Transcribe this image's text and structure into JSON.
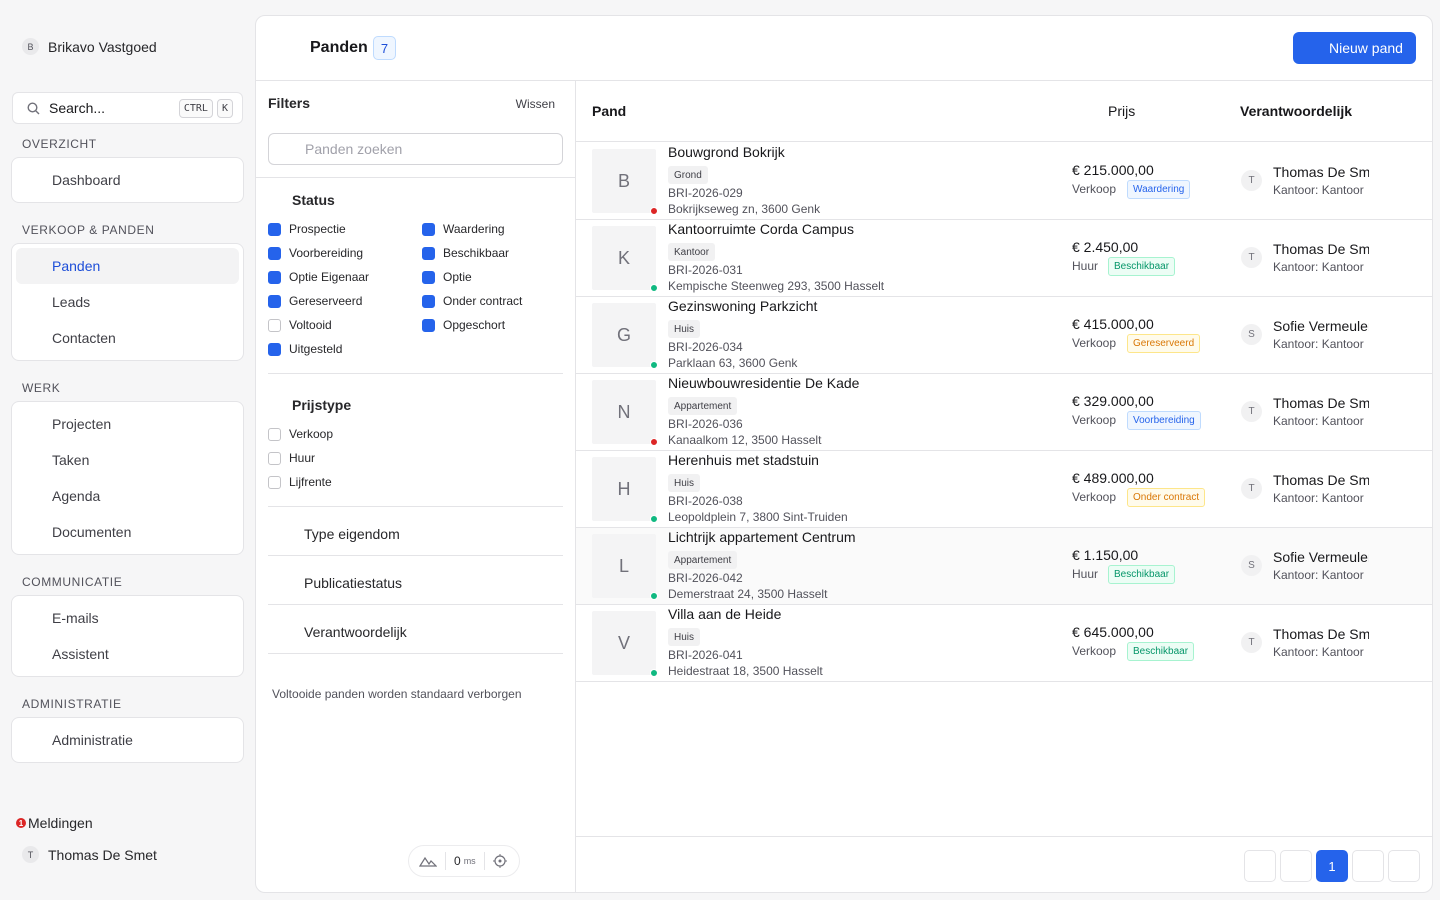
{
  "sidebar": {
    "brand": {
      "initial": "B",
      "name": "Brikavo Vastgoed"
    },
    "search": {
      "placeholder": "Search...",
      "keys": [
        "CTRL",
        "K"
      ]
    },
    "sections": [
      {
        "label": "OVERZICHT",
        "items": [
          "Dashboard"
        ]
      },
      {
        "label": "VERKOOP & PANDEN",
        "items": [
          "Panden",
          "Leads",
          "Contacten"
        ],
        "active": "Panden"
      },
      {
        "label": "WERK",
        "items": [
          "Projecten",
          "Taken",
          "Agenda",
          "Documenten"
        ]
      },
      {
        "label": "COMMUNICATIE",
        "items": [
          "E-mails",
          "Assistent"
        ]
      },
      {
        "label": "ADMINISTRATIE",
        "items": [
          "Administratie"
        ]
      }
    ],
    "notifications": {
      "label": "Meldingen",
      "count": "1"
    },
    "user": {
      "initial": "T",
      "name": "Thomas De Smet"
    }
  },
  "header": {
    "title": "Panden",
    "count": "7",
    "new_button": "Nieuw pand"
  },
  "filters": {
    "title": "Filters",
    "clear": "Wissen",
    "search_placeholder": "Panden zoeken",
    "status_title": "Status",
    "status": [
      {
        "label": "Prospectie",
        "checked": true
      },
      {
        "label": "Waardering",
        "checked": true
      },
      {
        "label": "Voorbereiding",
        "checked": true
      },
      {
        "label": "Beschikbaar",
        "checked": true
      },
      {
        "label": "Optie Eigenaar",
        "checked": true
      },
      {
        "label": "Optie",
        "checked": true
      },
      {
        "label": "Gereserveerd",
        "checked": true
      },
      {
        "label": "Onder contract",
        "checked": true
      },
      {
        "label": "Voltooid",
        "checked": false
      },
      {
        "label": "Opgeschort",
        "checked": true
      },
      {
        "label": "Uitgesteld",
        "checked": true
      }
    ],
    "price_type_title": "Prijstype",
    "price_types": [
      {
        "label": "Verkoop",
        "checked": false
      },
      {
        "label": "Huur",
        "checked": false
      },
      {
        "label": "Lijfrente",
        "checked": false
      }
    ],
    "sections": [
      "Type eigendom",
      "Publicatiestatus",
      "Verantwoordelijk"
    ],
    "note": "Voltooide panden worden standaard verborgen"
  },
  "table": {
    "columns": {
      "pand": "Pand",
      "prijs": "Prijs",
      "verantwoordelijk": "Verantwoordelijk"
    },
    "rows": [
      {
        "initial": "B",
        "name": "Bouwgrond Bokrijk",
        "type": "Grond",
        "ref": "BRI-2026-029",
        "address": "Bokrijkseweg zn, 3600 Genk",
        "price": "€ 215.000,00",
        "price_type": "Verkoop",
        "status": "Waardering",
        "status_color": "blue",
        "dot_color": "#dc2626",
        "owner_initial": "T",
        "owner": "Thomas De Smet",
        "office": "Kantoor: Kantoor"
      },
      {
        "initial": "K",
        "name": "Kantoorruimte Corda Campus",
        "type": "Kantoor",
        "ref": "BRI-2026-031",
        "address": "Kempische Steenweg 293, 3500 Hasselt",
        "price": "€ 2.450,00",
        "price_type": "Huur",
        "status": "Beschikbaar",
        "status_color": "green",
        "dot_color": "#10b981",
        "owner_initial": "T",
        "owner": "Thomas De Smet",
        "office": "Kantoor: Kantoor"
      },
      {
        "initial": "G",
        "name": "Gezinswoning Parkzicht",
        "type": "Huis",
        "ref": "BRI-2026-034",
        "address": "Parklaan 63, 3600 Genk",
        "price": "€ 415.000,00",
        "price_type": "Verkoop",
        "status": "Gereserveerd",
        "status_color": "amber",
        "dot_color": "#10b981",
        "owner_initial": "S",
        "owner": "Sofie Vermeulen",
        "office": "Kantoor: Kantoor"
      },
      {
        "initial": "N",
        "name": "Nieuwbouwresidentie De Kade",
        "type": "Appartement",
        "ref": "BRI-2026-036",
        "address": "Kanaalkom 12, 3500 Hasselt",
        "price": "€ 329.000,00",
        "price_type": "Verkoop",
        "status": "Voorbereiding",
        "status_color": "blue",
        "dot_color": "#dc2626",
        "owner_initial": "T",
        "owner": "Thomas De Smet",
        "office": "Kantoor: Kantoor"
      },
      {
        "initial": "H",
        "name": "Herenhuis met stadstuin",
        "type": "Huis",
        "ref": "BRI-2026-038",
        "address": "Leopoldplein 7, 3800 Sint-Truiden",
        "price": "€ 489.000,00",
        "price_type": "Verkoop",
        "status": "Onder contract",
        "status_color": "amber",
        "dot_color": "#10b981",
        "owner_initial": "T",
        "owner": "Thomas De Smet",
        "office": "Kantoor: Kantoor"
      },
      {
        "initial": "L",
        "name": "Lichtrijk appartement Centrum",
        "type": "Appartement",
        "ref": "BRI-2026-042",
        "address": "Demerstraat 24, 3500 Hasselt",
        "price": "€ 1.150,00",
        "price_type": "Huur",
        "status": "Beschikbaar",
        "status_color": "green",
        "dot_color": "#10b981",
        "owner_initial": "S",
        "owner": "Sofie Vermeulen",
        "office": "Kantoor: Kantoor"
      },
      {
        "initial": "V",
        "name": "Villa aan de Heide",
        "type": "Huis",
        "ref": "BRI-2026-041",
        "address": "Heidestraat 18, 3500 Hasselt",
        "price": "€ 645.000,00",
        "price_type": "Verkoop",
        "status": "Beschikbaar",
        "status_color": "green",
        "dot_color": "#10b981",
        "owner_initial": "T",
        "owner": "Thomas De Smet",
        "office": "Kantoor: Kantoor"
      }
    ]
  },
  "pagination": {
    "current": "1"
  },
  "perf": {
    "value": "0",
    "unit": "ms"
  },
  "colors": {
    "accent": "#2563eb",
    "alert": "#dc2626",
    "ok": "#10b981"
  }
}
